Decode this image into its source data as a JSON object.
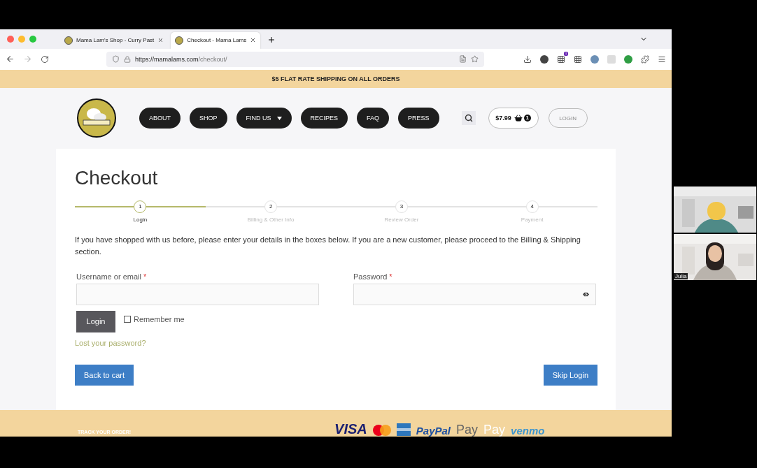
{
  "browser": {
    "tabs": [
      {
        "title": "Mama Lam's Shop - Curry Past",
        "selected": false
      },
      {
        "title": "Checkout - Mama Lams",
        "selected": true
      }
    ],
    "url_host": "https://mamalams.com",
    "url_path": "/checkout/",
    "extension_badge": "!"
  },
  "banner": "$5 FLAT RATE SHIPPING ON ALL ORDERS",
  "nav": [
    {
      "label": "ABOUT",
      "kind": "link"
    },
    {
      "label": "SHOP",
      "kind": "link"
    },
    {
      "label": "FIND US",
      "kind": "dropdown"
    },
    {
      "label": "RECIPES",
      "kind": "link"
    },
    {
      "label": "FAQ",
      "kind": "link"
    },
    {
      "label": "PRESS",
      "kind": "link"
    }
  ],
  "cart": {
    "total": "$7.99",
    "count": "1"
  },
  "login_link": "LOGIN",
  "checkout": {
    "title": "Checkout",
    "steps": [
      {
        "number": "1",
        "label": "Login",
        "selected": true
      },
      {
        "number": "2",
        "label": "Billing & Other Info",
        "selected": false
      },
      {
        "number": "3",
        "label": "Review Order",
        "selected": false
      },
      {
        "number": "4",
        "label": "Payment",
        "selected": false
      }
    ],
    "intro": "If you have shopped with us before, please enter your details in the boxes below. If you are a new customer, please proceed to the Billing & Shipping section.",
    "fields": [
      {
        "label": "Username or email",
        "required_mark": "*",
        "kind": "text"
      },
      {
        "label": "Password",
        "required_mark": "*",
        "kind": "password"
      }
    ],
    "login_button": "Login",
    "remember": {
      "label": "Remember me",
      "checked": false
    },
    "lost_password": "Lost your password?",
    "back_button": "Back to cart",
    "skip_button": "Skip Login"
  },
  "footer": {
    "track": "TRACK YOUR ORDER!",
    "payments": [
      {
        "kind": "text",
        "label": "VISA"
      },
      {
        "kind": "mastercard"
      },
      {
        "kind": "amex"
      },
      {
        "kind": "paypal",
        "label": "PayPal"
      },
      {
        "kind": "gpay",
        "label": "Pay"
      },
      {
        "kind": "applepay",
        "label": "Pay"
      },
      {
        "kind": "venmo",
        "label": "venmo"
      }
    ]
  },
  "participants": [
    {
      "kind": "picture"
    },
    {
      "kind": "picture",
      "name": "Julia"
    }
  ]
}
